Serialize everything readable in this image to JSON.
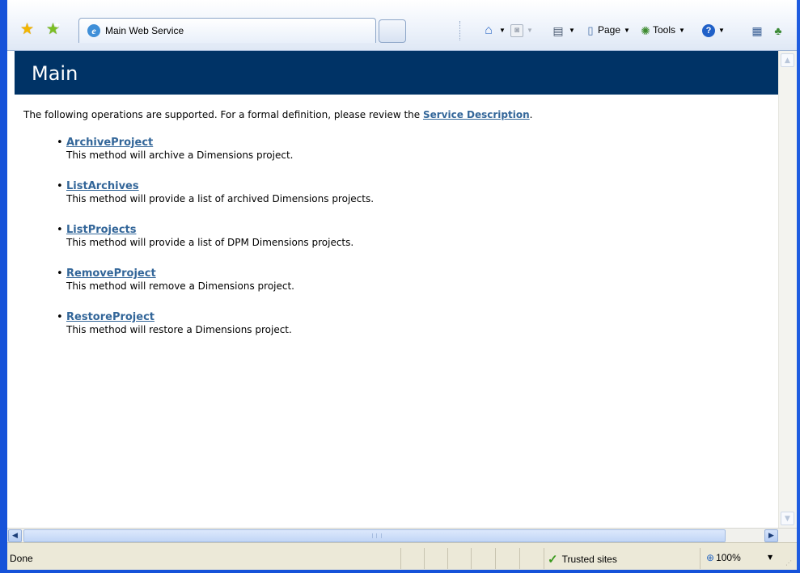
{
  "browser": {
    "tab_title": "Main Web Service",
    "toolbar": {
      "page_label": "Page",
      "tools_label": "Tools"
    }
  },
  "page": {
    "heading": "Main",
    "intro_text": "The following operations are supported. For a formal definition, please review the ",
    "intro_link": "Service Description",
    "intro_end": ".",
    "operations": [
      {
        "name": "ArchiveProject",
        "description": "This method will archive a Dimensions project."
      },
      {
        "name": "ListArchives",
        "description": "This method will provide a list of archived Dimensions projects."
      },
      {
        "name": "ListProjects",
        "description": "This method will provide a list of DPM Dimensions projects."
      },
      {
        "name": "RemoveProject",
        "description": "This method will remove a Dimensions project."
      },
      {
        "name": "RestoreProject",
        "description": "This method will restore a Dimensions project."
      }
    ]
  },
  "status_bar": {
    "status": "Done",
    "zone": "Trusted sites",
    "zoom": "100%"
  },
  "colors": {
    "header_bg": "#003366",
    "link": "#336699",
    "frame": "#1652d9"
  },
  "icons": [
    "favorites-star-icon",
    "add-favorites-icon",
    "ie-page-icon",
    "home-icon",
    "feeds-icon",
    "print-icon",
    "page-icon",
    "tools-gear-icon",
    "help-icon",
    "research-icon",
    "messenger-icon",
    "check-icon",
    "zoom-icon"
  ]
}
